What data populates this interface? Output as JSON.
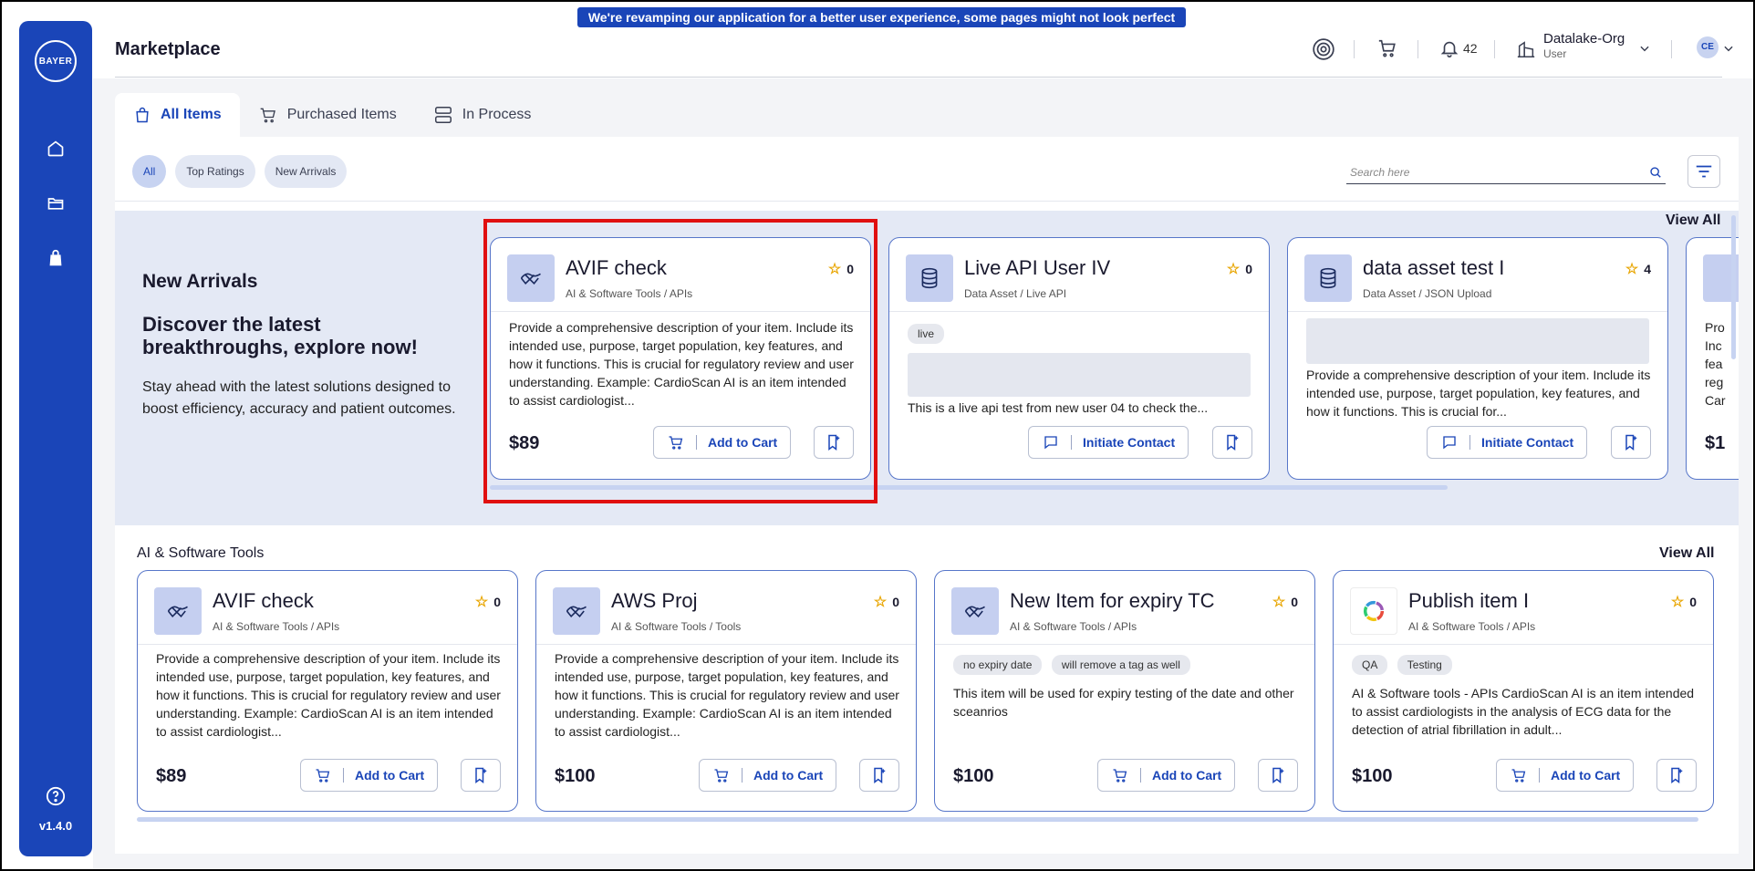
{
  "banner": "We're revamping our application for a better user experience, some pages might not look perfect yet!",
  "sidebar": {
    "logo_h": "BAYER",
    "logo_v": "B A Y E R",
    "version": "v1.4.0"
  },
  "header": {
    "title": "Marketplace",
    "notification_count": "42",
    "org_name": "Datalake-Org",
    "org_role": "User",
    "avatar_initials": "CE"
  },
  "tabs": [
    {
      "label": "All Items",
      "icon": "bag-icon"
    },
    {
      "label": "Purchased Items",
      "icon": "cart-icon"
    },
    {
      "label": "In Process",
      "icon": "stack-icon"
    }
  ],
  "chips": [
    "All",
    "Top Ratings",
    "New Arrivals"
  ],
  "search": {
    "placeholder": "Search here"
  },
  "new_arrivals": {
    "heading": "New Arrivals",
    "subheading": "Discover the latest breakthroughs, explore now!",
    "text": "Stay ahead with the latest solutions designed to boost efficiency, accuracy and patient outcomes.",
    "view_all": "View All",
    "cards": [
      {
        "title": "AVIF check",
        "category": "AI & Software Tools / APIs",
        "rating": "0",
        "description": "Provide a comprehensive description of your item. Include its intended use, purpose, target population, key features, and how it functions. This is crucial for regulatory review and user understanding. Example: CardioScan AI is an item intended to assist cardiologist...",
        "price": "$89",
        "action": "Add to Cart"
      },
      {
        "title": "Live API User IV",
        "category": "Data Asset / Live API",
        "rating": "0",
        "tags": [
          "live"
        ],
        "description": "This is a live api test from new user 04 to check the...",
        "action": "Initiate Contact"
      },
      {
        "title": "data asset test I",
        "category": "Data Asset / JSON Upload",
        "rating": "4",
        "description": "Provide a comprehensive description of your item. Include its intended use, purpose, target population, key features, and how it functions. This is crucial for...",
        "action": "Initiate Contact"
      },
      {
        "partial_desc": "Pro\nInc\nfea\nreg\nCar",
        "partial_price": "$1"
      }
    ]
  },
  "ai_tools": {
    "heading": "AI & Software Tools",
    "view_all": "View All",
    "cards": [
      {
        "title": "AVIF check",
        "category": "AI & Software Tools / APIs",
        "rating": "0",
        "description": "Provide a comprehensive description of your item. Include its intended use, purpose, target population, key features, and how it functions. This is crucial for regulatory review and user understanding. Example: CardioScan AI is an item intended to assist cardiologist...",
        "price": "$89",
        "action": "Add to Cart"
      },
      {
        "title": "AWS Proj",
        "category": "AI & Software Tools / Tools",
        "rating": "0",
        "description": "Provide a comprehensive description of your item. Include its intended use, purpose, target population, key features, and how it functions. This is crucial for regulatory review and user understanding. Example: CardioScan AI is an item intended to assist cardiologist...",
        "price": "$100",
        "action": "Add to Cart"
      },
      {
        "title": "New Item for expiry TC",
        "category": "AI & Software Tools / APIs",
        "rating": "0",
        "tags": [
          "no expiry date",
          "will remove a tag as well"
        ],
        "description": "This item will be used for expiry testing of the date and other sceanrios",
        "price": "$100",
        "action": "Add to Cart"
      },
      {
        "title": "Publish item I",
        "category": "AI & Software Tools / APIs",
        "rating": "0",
        "tags": [
          "QA",
          "Testing"
        ],
        "description": "AI & Software tools - APIs CardioScan AI is an item intended to assist cardiologists in the analysis of ECG data for the detection of atrial fibrillation in adult...",
        "price": "$100",
        "action": "Add to Cart"
      }
    ]
  },
  "colors": {
    "primary": "#1a45b8",
    "highlight": "#e01010",
    "star": "#e8a500"
  }
}
